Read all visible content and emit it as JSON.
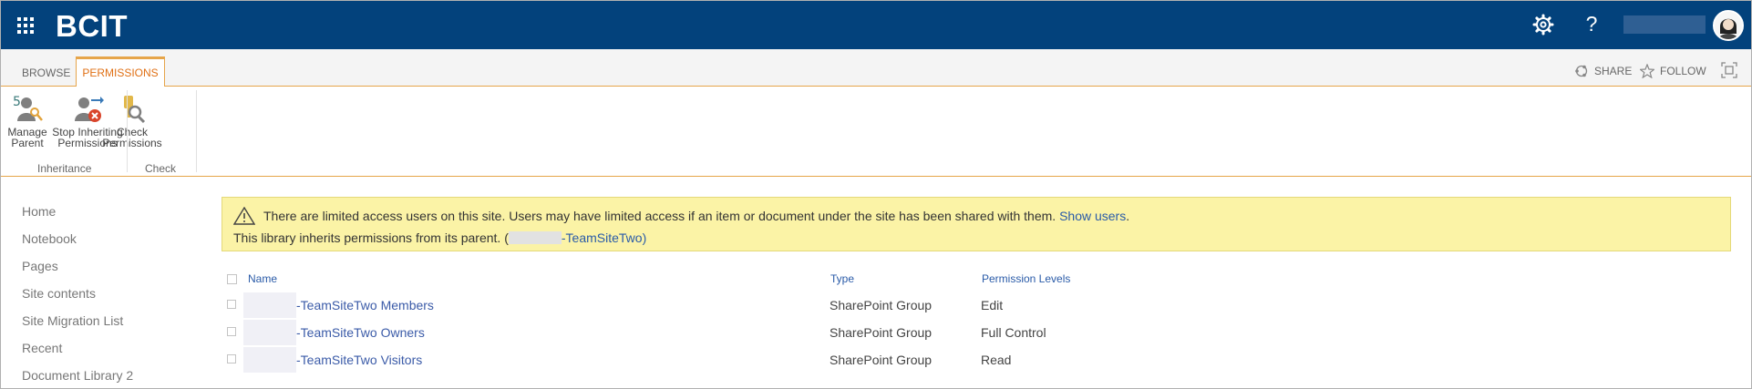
{
  "suite": {
    "brand": "BCIT",
    "help_glyph": "?",
    "icons": [
      "waffle-icon",
      "gear-icon",
      "help-icon",
      "avatar"
    ]
  },
  "tabs": {
    "browse": "BROWSE",
    "permissions": "PERMISSIONS"
  },
  "actions": {
    "share": "SHARE",
    "follow": "FOLLOW"
  },
  "ribbon": {
    "manage_parent": [
      "Manage",
      "Parent"
    ],
    "stop_inheriting": [
      "Stop Inheriting",
      "Permissions"
    ],
    "check_permissions": [
      "Check",
      "Permissions"
    ],
    "group_inheritance": "Inheritance",
    "group_check": "Check"
  },
  "nav": {
    "items": [
      "Home",
      "Notebook",
      "Pages",
      "Site contents",
      "Site Migration List",
      "Recent",
      "Document Library 2"
    ]
  },
  "banner": {
    "line1": "There are limited access users on this site. Users may have limited access if an item or document under the site has been shared with them.",
    "show_users": "Show users",
    "line1_end": ".",
    "line2_prefix": "This library inherits permissions from its parent. (",
    "parent_link": "-TeamSiteTwo)"
  },
  "table": {
    "headers": {
      "name": "Name",
      "type": "Type",
      "levels": "Permission Levels"
    },
    "rows": [
      {
        "name": "-TeamSiteTwo Members",
        "type": "SharePoint Group",
        "level": "Edit"
      },
      {
        "name": "-TeamSiteTwo Owners",
        "type": "SharePoint Group",
        "level": "Full Control"
      },
      {
        "name": "-TeamSiteTwo Visitors",
        "type": "SharePoint Group",
        "level": "Read"
      }
    ]
  },
  "colors": {
    "suitebar": "#03427c",
    "accent": "#e07015",
    "link": "#2a5ba8",
    "banner": "#fbf3a6"
  }
}
